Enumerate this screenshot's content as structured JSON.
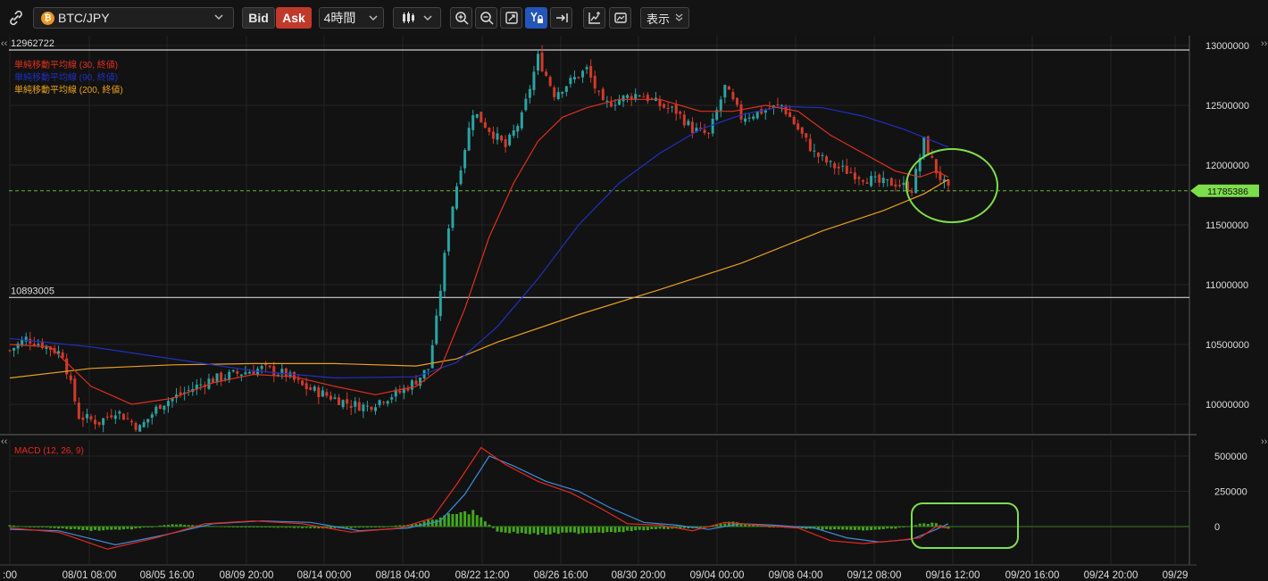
{
  "toolbar": {
    "link_icon": "link-icon",
    "pair": "BTC/JPY",
    "coin_glyph": "₿",
    "bid": "Bid",
    "ask": "Ask",
    "timeframe": "4時間",
    "chart_type_icon": "candlestick-icon",
    "tools": [
      "zoom-in-icon",
      "zoom-out-icon",
      "fit-icon",
      "y-axis-lock-icon",
      "scroll-to-end-icon",
      "indicator-icon",
      "snapshot-icon"
    ],
    "display_label": "表示"
  },
  "colors": {
    "up": "#2ba3a3",
    "down": "#d23a2a",
    "sma30": "#e0301e",
    "sma90": "#2030c0",
    "sma200": "#e8a020",
    "macd": "#e8281e",
    "signal": "#3c8cdc",
    "hist": "#42a61e",
    "price_tag": "#7dde4c",
    "annotation": "#7dde4c"
  },
  "chart_data": [
    {
      "type": "candlestick",
      "title": "BTC/JPY",
      "legend": [
        "単純移動平均線 (30, 終値)",
        "単純移動平均線 (90, 終値)",
        "単純移動平均線 (200, 終値)"
      ],
      "x_ticks": [
        ":00",
        "08/01 08:00",
        "08/05 16:00",
        "08/09 20:00",
        "08/14 00:00",
        "08/18 04:00",
        "08/22 12:00",
        "08/26 16:00",
        "08/30 20:00",
        "09/04 00:00",
        "09/08 04:00",
        "09/12 08:00",
        "09/16 12:00",
        "09/20 16:00",
        "09/24 20:00",
        "09/29"
      ],
      "y_ticks": [
        "13000000",
        "12500000",
        "12000000",
        "11500000",
        "11000000",
        "10500000",
        "10000000"
      ],
      "ylim": [
        9750000,
        13150000
      ],
      "hlines": [
        {
          "value": 12962722,
          "label": "12962722"
        },
        {
          "value": 10893005,
          "label": "10893005"
        }
      ],
      "current_price": {
        "value": 11785386,
        "label": "11785386"
      },
      "close_series": [
        {
          "x": 0,
          "y": 10450000
        },
        {
          "x": 4,
          "y": 10550000
        },
        {
          "x": 8,
          "y": 10500000
        },
        {
          "x": 13,
          "y": 10420000
        },
        {
          "x": 17,
          "y": 9900000
        },
        {
          "x": 22,
          "y": 9850000
        },
        {
          "x": 26,
          "y": 9950000
        },
        {
          "x": 32,
          "y": 9800000
        },
        {
          "x": 37,
          "y": 10000000
        },
        {
          "x": 43,
          "y": 10100000
        },
        {
          "x": 49,
          "y": 10200000
        },
        {
          "x": 55,
          "y": 10250000
        },
        {
          "x": 62,
          "y": 10300000
        },
        {
          "x": 68,
          "y": 10250000
        },
        {
          "x": 72,
          "y": 10150000
        },
        {
          "x": 76,
          "y": 10100000
        },
        {
          "x": 80,
          "y": 10050000
        },
        {
          "x": 84,
          "y": 10000000
        },
        {
          "x": 88,
          "y": 9980000
        },
        {
          "x": 92,
          "y": 10050000
        },
        {
          "x": 96,
          "y": 10100000
        },
        {
          "x": 100,
          "y": 10200000
        },
        {
          "x": 103,
          "y": 10300000
        },
        {
          "x": 105,
          "y": 10700000
        },
        {
          "x": 108,
          "y": 11500000
        },
        {
          "x": 111,
          "y": 12000000
        },
        {
          "x": 114,
          "y": 12450000
        },
        {
          "x": 118,
          "y": 12300000
        },
        {
          "x": 122,
          "y": 12150000
        },
        {
          "x": 126,
          "y": 12400000
        },
        {
          "x": 130,
          "y": 12900000
        },
        {
          "x": 134,
          "y": 12600000
        },
        {
          "x": 138,
          "y": 12700000
        },
        {
          "x": 142,
          "y": 12800000
        },
        {
          "x": 146,
          "y": 12500000
        },
        {
          "x": 150,
          "y": 12550000
        },
        {
          "x": 155,
          "y": 12600000
        },
        {
          "x": 160,
          "y": 12500000
        },
        {
          "x": 164,
          "y": 12450000
        },
        {
          "x": 168,
          "y": 12300000
        },
        {
          "x": 172,
          "y": 12250000
        },
        {
          "x": 176,
          "y": 12650000
        },
        {
          "x": 180,
          "y": 12400000
        },
        {
          "x": 185,
          "y": 12450000
        },
        {
          "x": 190,
          "y": 12500000
        },
        {
          "x": 194,
          "y": 12300000
        },
        {
          "x": 198,
          "y": 12100000
        },
        {
          "x": 202,
          "y": 12000000
        },
        {
          "x": 206,
          "y": 11950000
        },
        {
          "x": 210,
          "y": 11900000
        },
        {
          "x": 214,
          "y": 11850000
        },
        {
          "x": 218,
          "y": 11850000
        },
        {
          "x": 222,
          "y": 11800000
        },
        {
          "x": 225,
          "y": 12200000
        },
        {
          "x": 228,
          "y": 11950000
        },
        {
          "x": 231,
          "y": 11785386
        }
      ],
      "sma30": [
        {
          "x": 0,
          "y": 10500000
        },
        {
          "x": 10,
          "y": 10480000
        },
        {
          "x": 20,
          "y": 10150000
        },
        {
          "x": 30,
          "y": 10000000
        },
        {
          "x": 40,
          "y": 10050000
        },
        {
          "x": 50,
          "y": 10180000
        },
        {
          "x": 60,
          "y": 10250000
        },
        {
          "x": 70,
          "y": 10230000
        },
        {
          "x": 80,
          "y": 10150000
        },
        {
          "x": 90,
          "y": 10080000
        },
        {
          "x": 100,
          "y": 10150000
        },
        {
          "x": 106,
          "y": 10300000
        },
        {
          "x": 112,
          "y": 10800000
        },
        {
          "x": 118,
          "y": 11400000
        },
        {
          "x": 124,
          "y": 11850000
        },
        {
          "x": 130,
          "y": 12200000
        },
        {
          "x": 136,
          "y": 12400000
        },
        {
          "x": 142,
          "y": 12480000
        },
        {
          "x": 150,
          "y": 12550000
        },
        {
          "x": 160,
          "y": 12550000
        },
        {
          "x": 170,
          "y": 12450000
        },
        {
          "x": 178,
          "y": 12450000
        },
        {
          "x": 186,
          "y": 12500000
        },
        {
          "x": 194,
          "y": 12450000
        },
        {
          "x": 202,
          "y": 12250000
        },
        {
          "x": 210,
          "y": 12100000
        },
        {
          "x": 218,
          "y": 11950000
        },
        {
          "x": 224,
          "y": 11900000
        },
        {
          "x": 228,
          "y": 11950000
        },
        {
          "x": 231,
          "y": 11900000
        }
      ],
      "sma90": [
        {
          "x": 0,
          "y": 10550000
        },
        {
          "x": 20,
          "y": 10480000
        },
        {
          "x": 40,
          "y": 10380000
        },
        {
          "x": 60,
          "y": 10280000
        },
        {
          "x": 80,
          "y": 10220000
        },
        {
          "x": 100,
          "y": 10230000
        },
        {
          "x": 110,
          "y": 10350000
        },
        {
          "x": 120,
          "y": 10650000
        },
        {
          "x": 130,
          "y": 11050000
        },
        {
          "x": 140,
          "y": 11500000
        },
        {
          "x": 150,
          "y": 11850000
        },
        {
          "x": 160,
          "y": 12100000
        },
        {
          "x": 170,
          "y": 12300000
        },
        {
          "x": 180,
          "y": 12420000
        },
        {
          "x": 190,
          "y": 12490000
        },
        {
          "x": 200,
          "y": 12480000
        },
        {
          "x": 210,
          "y": 12410000
        },
        {
          "x": 220,
          "y": 12300000
        },
        {
          "x": 231,
          "y": 12150000
        }
      ],
      "sma200": [
        {
          "x": 0,
          "y": 10220000
        },
        {
          "x": 20,
          "y": 10300000
        },
        {
          "x": 40,
          "y": 10330000
        },
        {
          "x": 60,
          "y": 10340000
        },
        {
          "x": 80,
          "y": 10340000
        },
        {
          "x": 100,
          "y": 10320000
        },
        {
          "x": 110,
          "y": 10380000
        },
        {
          "x": 120,
          "y": 10520000
        },
        {
          "x": 140,
          "y": 10750000
        },
        {
          "x": 160,
          "y": 10960000
        },
        {
          "x": 180,
          "y": 11180000
        },
        {
          "x": 200,
          "y": 11450000
        },
        {
          "x": 215,
          "y": 11620000
        },
        {
          "x": 225,
          "y": 11760000
        },
        {
          "x": 231,
          "y": 11880000
        }
      ]
    },
    {
      "type": "line",
      "title": "MACD (12, 26, 9)",
      "y_ticks": [
        "500000",
        "250000",
        "0"
      ],
      "ylim": [
        -200000,
        640000
      ],
      "macd": [
        {
          "x": 0,
          "y": -10000
        },
        {
          "x": 12,
          "y": -40000
        },
        {
          "x": 24,
          "y": -160000
        },
        {
          "x": 36,
          "y": -80000
        },
        {
          "x": 48,
          "y": 20000
        },
        {
          "x": 60,
          "y": 40000
        },
        {
          "x": 72,
          "y": 20000
        },
        {
          "x": 84,
          "y": -40000
        },
        {
          "x": 96,
          "y": -10000
        },
        {
          "x": 104,
          "y": 60000
        },
        {
          "x": 110,
          "y": 300000
        },
        {
          "x": 116,
          "y": 560000
        },
        {
          "x": 122,
          "y": 440000
        },
        {
          "x": 130,
          "y": 320000
        },
        {
          "x": 138,
          "y": 240000
        },
        {
          "x": 146,
          "y": 120000
        },
        {
          "x": 152,
          "y": 20000
        },
        {
          "x": 160,
          "y": 10000
        },
        {
          "x": 168,
          "y": -30000
        },
        {
          "x": 176,
          "y": 30000
        },
        {
          "x": 184,
          "y": 10000
        },
        {
          "x": 194,
          "y": -10000
        },
        {
          "x": 202,
          "y": -100000
        },
        {
          "x": 210,
          "y": -120000
        },
        {
          "x": 218,
          "y": -100000
        },
        {
          "x": 224,
          "y": -80000
        },
        {
          "x": 228,
          "y": 0
        },
        {
          "x": 231,
          "y": -10000
        }
      ],
      "signal": [
        {
          "x": 0,
          "y": -20000
        },
        {
          "x": 12,
          "y": -30000
        },
        {
          "x": 26,
          "y": -130000
        },
        {
          "x": 38,
          "y": -60000
        },
        {
          "x": 50,
          "y": 20000
        },
        {
          "x": 62,
          "y": 40000
        },
        {
          "x": 74,
          "y": 30000
        },
        {
          "x": 86,
          "y": -30000
        },
        {
          "x": 98,
          "y": -10000
        },
        {
          "x": 106,
          "y": 40000
        },
        {
          "x": 112,
          "y": 230000
        },
        {
          "x": 118,
          "y": 500000
        },
        {
          "x": 124,
          "y": 430000
        },
        {
          "x": 132,
          "y": 320000
        },
        {
          "x": 140,
          "y": 250000
        },
        {
          "x": 148,
          "y": 130000
        },
        {
          "x": 156,
          "y": 30000
        },
        {
          "x": 164,
          "y": 10000
        },
        {
          "x": 172,
          "y": -20000
        },
        {
          "x": 180,
          "y": 20000
        },
        {
          "x": 188,
          "y": 10000
        },
        {
          "x": 198,
          "y": -10000
        },
        {
          "x": 206,
          "y": -80000
        },
        {
          "x": 214,
          "y": -110000
        },
        {
          "x": 222,
          "y": -90000
        },
        {
          "x": 228,
          "y": -20000
        },
        {
          "x": 231,
          "y": 20000
        }
      ],
      "histogram": [
        {
          "x": 0,
          "y": 10000
        },
        {
          "x": 10,
          "y": -10000
        },
        {
          "x": 20,
          "y": -30000
        },
        {
          "x": 30,
          "y": -20000
        },
        {
          "x": 40,
          "y": 20000
        },
        {
          "x": 50,
          "y": 5000
        },
        {
          "x": 60,
          "y": -5000
        },
        {
          "x": 70,
          "y": -10000
        },
        {
          "x": 80,
          "y": -15000
        },
        {
          "x": 90,
          "y": -5000
        },
        {
          "x": 100,
          "y": 20000
        },
        {
          "x": 108,
          "y": 90000
        },
        {
          "x": 114,
          "y": 120000
        },
        {
          "x": 120,
          "y": -40000
        },
        {
          "x": 130,
          "y": -60000
        },
        {
          "x": 140,
          "y": -50000
        },
        {
          "x": 150,
          "y": -40000
        },
        {
          "x": 160,
          "y": -20000
        },
        {
          "x": 170,
          "y": -10000
        },
        {
          "x": 178,
          "y": 40000
        },
        {
          "x": 188,
          "y": -5000
        },
        {
          "x": 198,
          "y": -20000
        },
        {
          "x": 208,
          "y": -30000
        },
        {
          "x": 218,
          "y": -15000
        },
        {
          "x": 224,
          "y": 20000
        },
        {
          "x": 228,
          "y": 30000
        },
        {
          "x": 231,
          "y": -20000
        }
      ]
    }
  ]
}
